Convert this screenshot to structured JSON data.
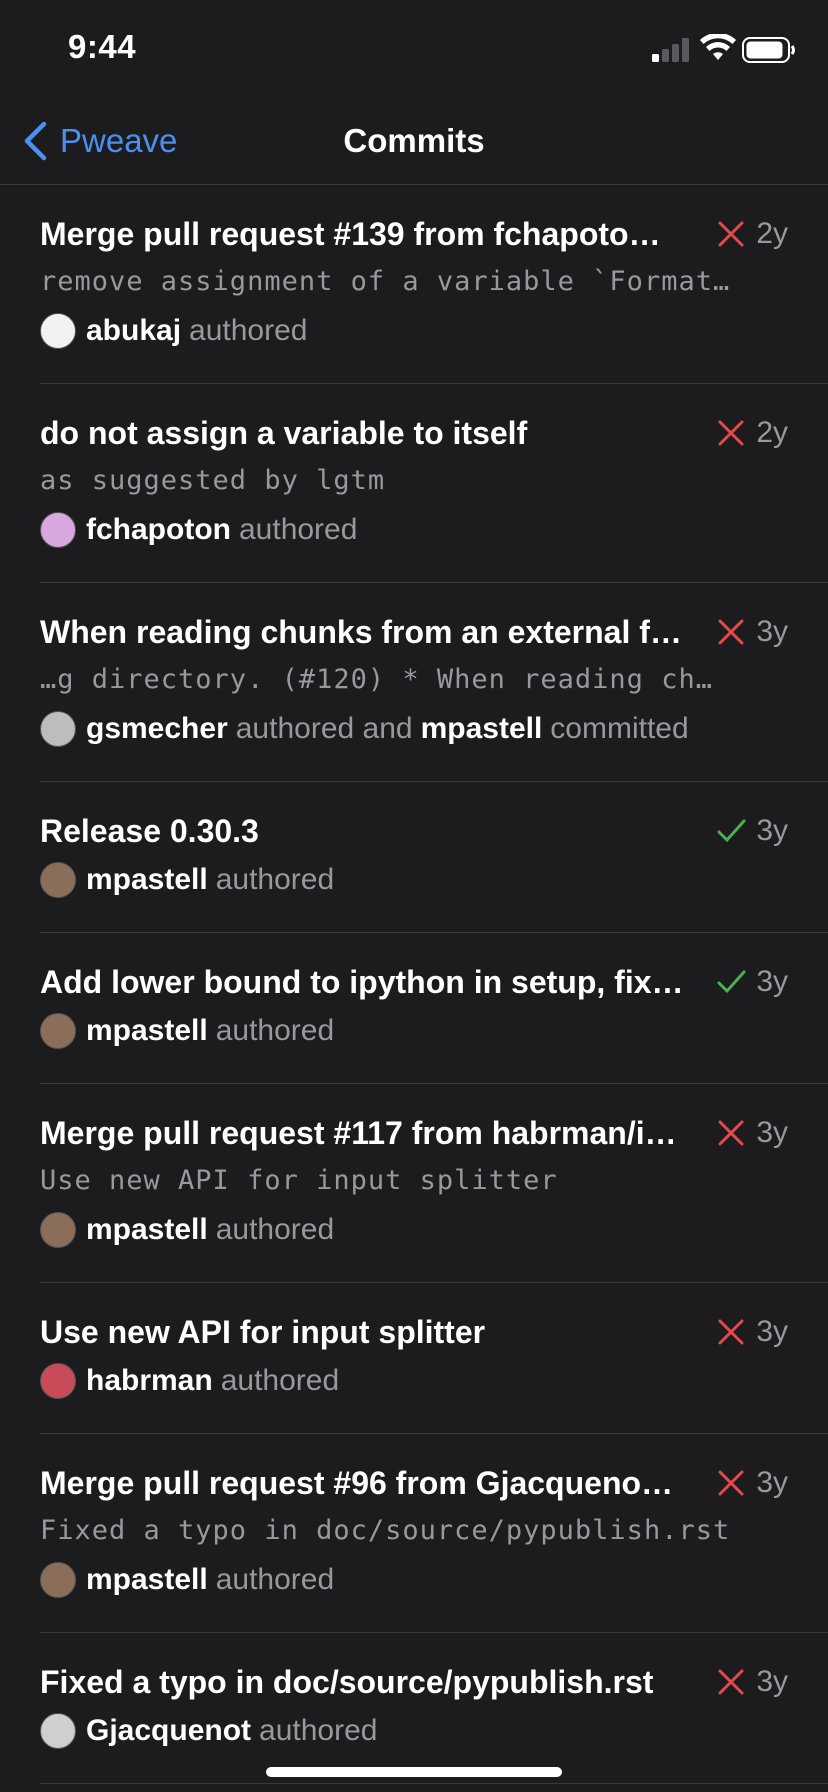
{
  "status_bar": {
    "time": "9:44"
  },
  "nav": {
    "back_label": "Pweave",
    "title": "Commits"
  },
  "commits": [
    {
      "title": "Merge pull request #139 from fchapoto…",
      "message": "remove assignment of a variable `Format…",
      "author": "abukaj",
      "verb": "authored",
      "committer": "",
      "verb2": "",
      "status": "fail",
      "age": "2y",
      "avatar_color": "#f2f2f2"
    },
    {
      "title": "do not assign a variable to itself",
      "message": "as suggested by lgtm",
      "author": "fchapoton",
      "verb": "authored",
      "committer": "",
      "verb2": "",
      "status": "fail",
      "age": "2y",
      "avatar_color": "#d9a7e0"
    },
    {
      "title": "When reading chunks from an external f…",
      "message": "…g directory. (#120)  * When reading ch…",
      "author": "gsmecher",
      "verb": "authored and",
      "committer": "mpastell",
      "verb2": "committed",
      "status": "fail",
      "age": "3y",
      "avatar_color": "#bdbdbd"
    },
    {
      "title": "Release 0.30.3",
      "message": "",
      "author": "mpastell",
      "verb": "authored",
      "committer": "",
      "verb2": "",
      "status": "success",
      "age": "3y",
      "avatar_color": "#8a6e5a"
    },
    {
      "title": "Add lower bound to ipython in setup, fix…",
      "message": "",
      "author": "mpastell",
      "verb": "authored",
      "committer": "",
      "verb2": "",
      "status": "success",
      "age": "3y",
      "avatar_color": "#8a6e5a"
    },
    {
      "title": "Merge pull request #117 from habrman/i…",
      "message": "Use new API for input splitter",
      "author": "mpastell",
      "verb": "authored",
      "committer": "",
      "verb2": "",
      "status": "fail",
      "age": "3y",
      "avatar_color": "#8a6e5a"
    },
    {
      "title": "Use new API for input splitter",
      "message": "",
      "author": "habrman",
      "verb": "authored",
      "committer": "",
      "verb2": "",
      "status": "fail",
      "age": "3y",
      "avatar_color": "#c94b5a"
    },
    {
      "title": "Merge pull request #96 from Gjacqueno…",
      "message": "Fixed a typo in doc/source/pypublish.rst",
      "author": "mpastell",
      "verb": "authored",
      "committer": "",
      "verb2": "",
      "status": "fail",
      "age": "3y",
      "avatar_color": "#8a6e5a"
    },
    {
      "title": "Fixed a typo in doc/source/pypublish.rst",
      "message": "",
      "author": "Gjacquenot",
      "verb": "authored",
      "committer": "",
      "verb2": "",
      "status": "fail",
      "age": "3y",
      "avatar_color": "#cfcfcf"
    }
  ],
  "colors": {
    "fail": "#e5484d",
    "success": "#4caf50",
    "link": "#4a90f2",
    "background": "#1c1c1e"
  }
}
